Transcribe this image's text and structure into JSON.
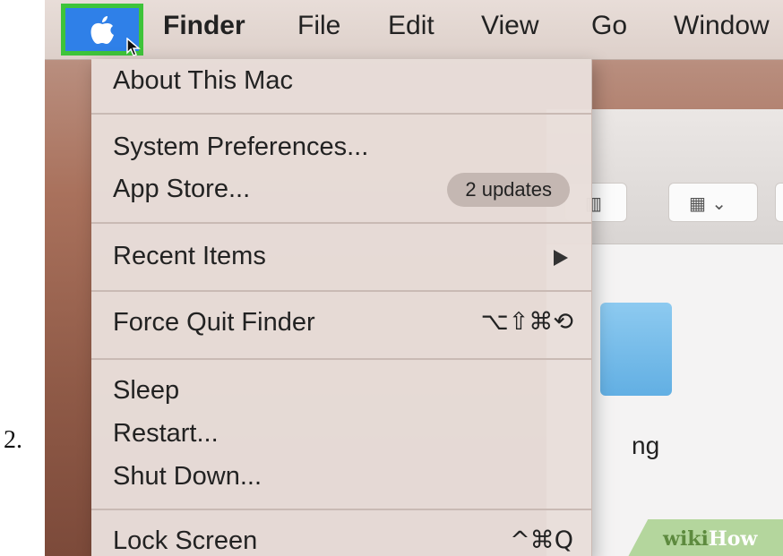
{
  "step_number": "2.",
  "menubar": {
    "items": [
      "Finder",
      "File",
      "Edit",
      "View",
      "Go",
      "Window"
    ]
  },
  "icons": {
    "apple": "apple-logo-icon",
    "cursor": "mouse-pointer-icon"
  },
  "apple_menu": {
    "about": "About This Mac",
    "system_preferences": "System Preferences...",
    "app_store": "App Store...",
    "app_store_badge": "2 updates",
    "recent_items": "Recent Items",
    "force_quit": "Force Quit Finder",
    "force_quit_shortcut": "⌥⇧⌘⟲",
    "sleep": "Sleep",
    "restart": "Restart...",
    "shut_down": "Shut Down...",
    "lock_screen": "Lock Screen",
    "lock_screen_shortcut": "^⌘Q"
  },
  "finder_window": {
    "partial_label": "ng"
  },
  "watermark": {
    "part1": "wiki",
    "part2": "How"
  },
  "colors": {
    "highlight": "#2f80e8",
    "highlight_outline": "#3ec43a"
  }
}
